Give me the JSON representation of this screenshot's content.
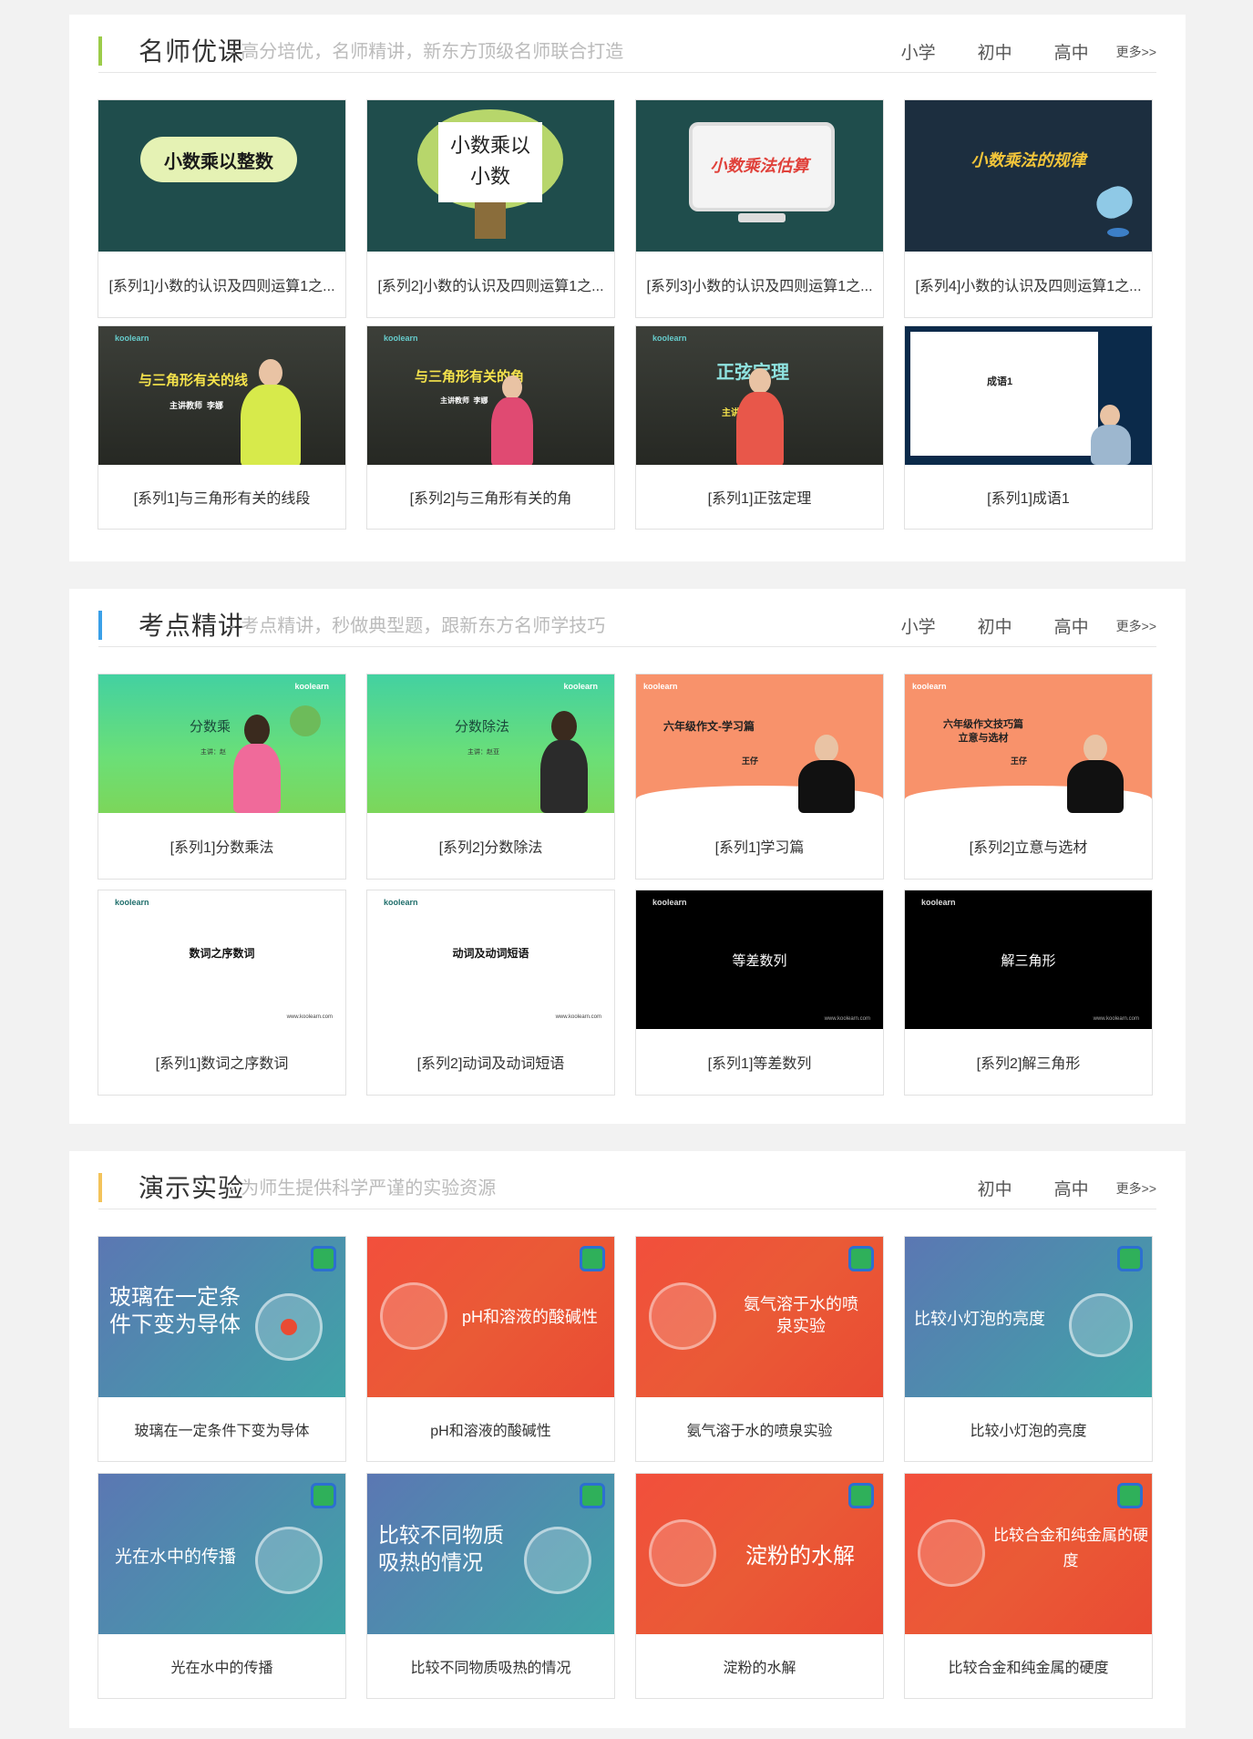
{
  "sections": [
    {
      "title": "名师优课",
      "subtitle": "- 高分培优，名师精讲，新东方顶级名师联合打造",
      "accent": "#9ccc4a",
      "nav": [
        "小学",
        "初中",
        "高中"
      ],
      "more": "更多>>",
      "cards": [
        {
          "caption": "[系列1]小数的认识及四则运算1之...",
          "thumb_text": "小数乘以整数"
        },
        {
          "caption": "[系列2]小数的认识及四则运算1之...",
          "thumb_text": "小数乘以小数"
        },
        {
          "caption": "[系列3]小数的认识及四则运算1之...",
          "thumb_text": "小数乘法估算"
        },
        {
          "caption": "[系列4]小数的认识及四则运算1之...",
          "thumb_text": "小数乘法的规律"
        },
        {
          "caption": "[系列1]与三角形有关的线段",
          "thumb_text": "与三角形有关的线",
          "thumb_sub": "主讲教师  李娜"
        },
        {
          "caption": "[系列2]与三角形有关的角",
          "thumb_text": "与三角形有关的角",
          "thumb_sub": "主讲教师  李娜"
        },
        {
          "caption": "[系列1]正弦定理",
          "thumb_text": "正弦定理",
          "thumb_sub": "主讲"
        },
        {
          "caption": "[系列1]成语1",
          "thumb_text": "成语1"
        }
      ]
    },
    {
      "title": "考点精讲",
      "subtitle": "- 考点精讲，秒做典型题，跟新东方名师学技巧",
      "accent": "#3aa0e8",
      "nav": [
        "小学",
        "初中",
        "高中"
      ],
      "more": "更多>>",
      "cards": [
        {
          "caption": "[系列1]分数乘法",
          "thumb_text": "分数乘",
          "thumb_sub": "主讲：赵"
        },
        {
          "caption": "[系列2]分数除法",
          "thumb_text": "分数除法",
          "thumb_sub": "主讲：赵亚"
        },
        {
          "caption": "[系列1]学习篇",
          "thumb_text": "六年级作文-学习篇",
          "thumb_sub": "王仔"
        },
        {
          "caption": "[系列2]立意与选材",
          "thumb_text": "六年级作文技巧篇 立意与选材",
          "thumb_sub": "王仔"
        },
        {
          "caption": "[系列1]数词之序数词",
          "thumb_text": "数词之序数词"
        },
        {
          "caption": "[系列2]动词及动词短语",
          "thumb_text": "动词及动词短语"
        },
        {
          "caption": "[系列1]等差数列",
          "thumb_text": "等差数列"
        },
        {
          "caption": "[系列2]解三角形",
          "thumb_text": "解三角形"
        }
      ]
    },
    {
      "title": "演示实验",
      "subtitle": "- 为师生提供科学严谨的实验资源",
      "accent": "#f3c35a",
      "nav": [
        "初中",
        "高中"
      ],
      "more": "更多>>",
      "cards": [
        {
          "caption": "玻璃在一定条件下变为导体",
          "thumb_text": "玻璃在一定条件下变为导体"
        },
        {
          "caption": "pH和溶液的酸碱性",
          "thumb_text": "pH和溶液的酸碱性"
        },
        {
          "caption": "氨气溶于水的喷泉实验",
          "thumb_text": "氨气溶于水的喷泉实验"
        },
        {
          "caption": "比较小灯泡的亮度",
          "thumb_text": "比较小灯泡的亮度"
        },
        {
          "caption": "光在水中的传播",
          "thumb_text": "光在水中的传播"
        },
        {
          "caption": "比较不同物质吸热的情况",
          "thumb_text": "比较不同物质吸热的情况"
        },
        {
          "caption": "淀粉的水解",
          "thumb_text": "淀粉的水解"
        },
        {
          "caption": "比较合金和纯金属的硬度",
          "thumb_text": "比较合金和纯金属的硬度"
        }
      ]
    }
  ],
  "brand": {
    "logo": "koolearn",
    "site": "www.koolearn.com"
  },
  "icons": {
    "lab": "microscope-atom-icon",
    "badge": "koolearn-badge-icon"
  }
}
